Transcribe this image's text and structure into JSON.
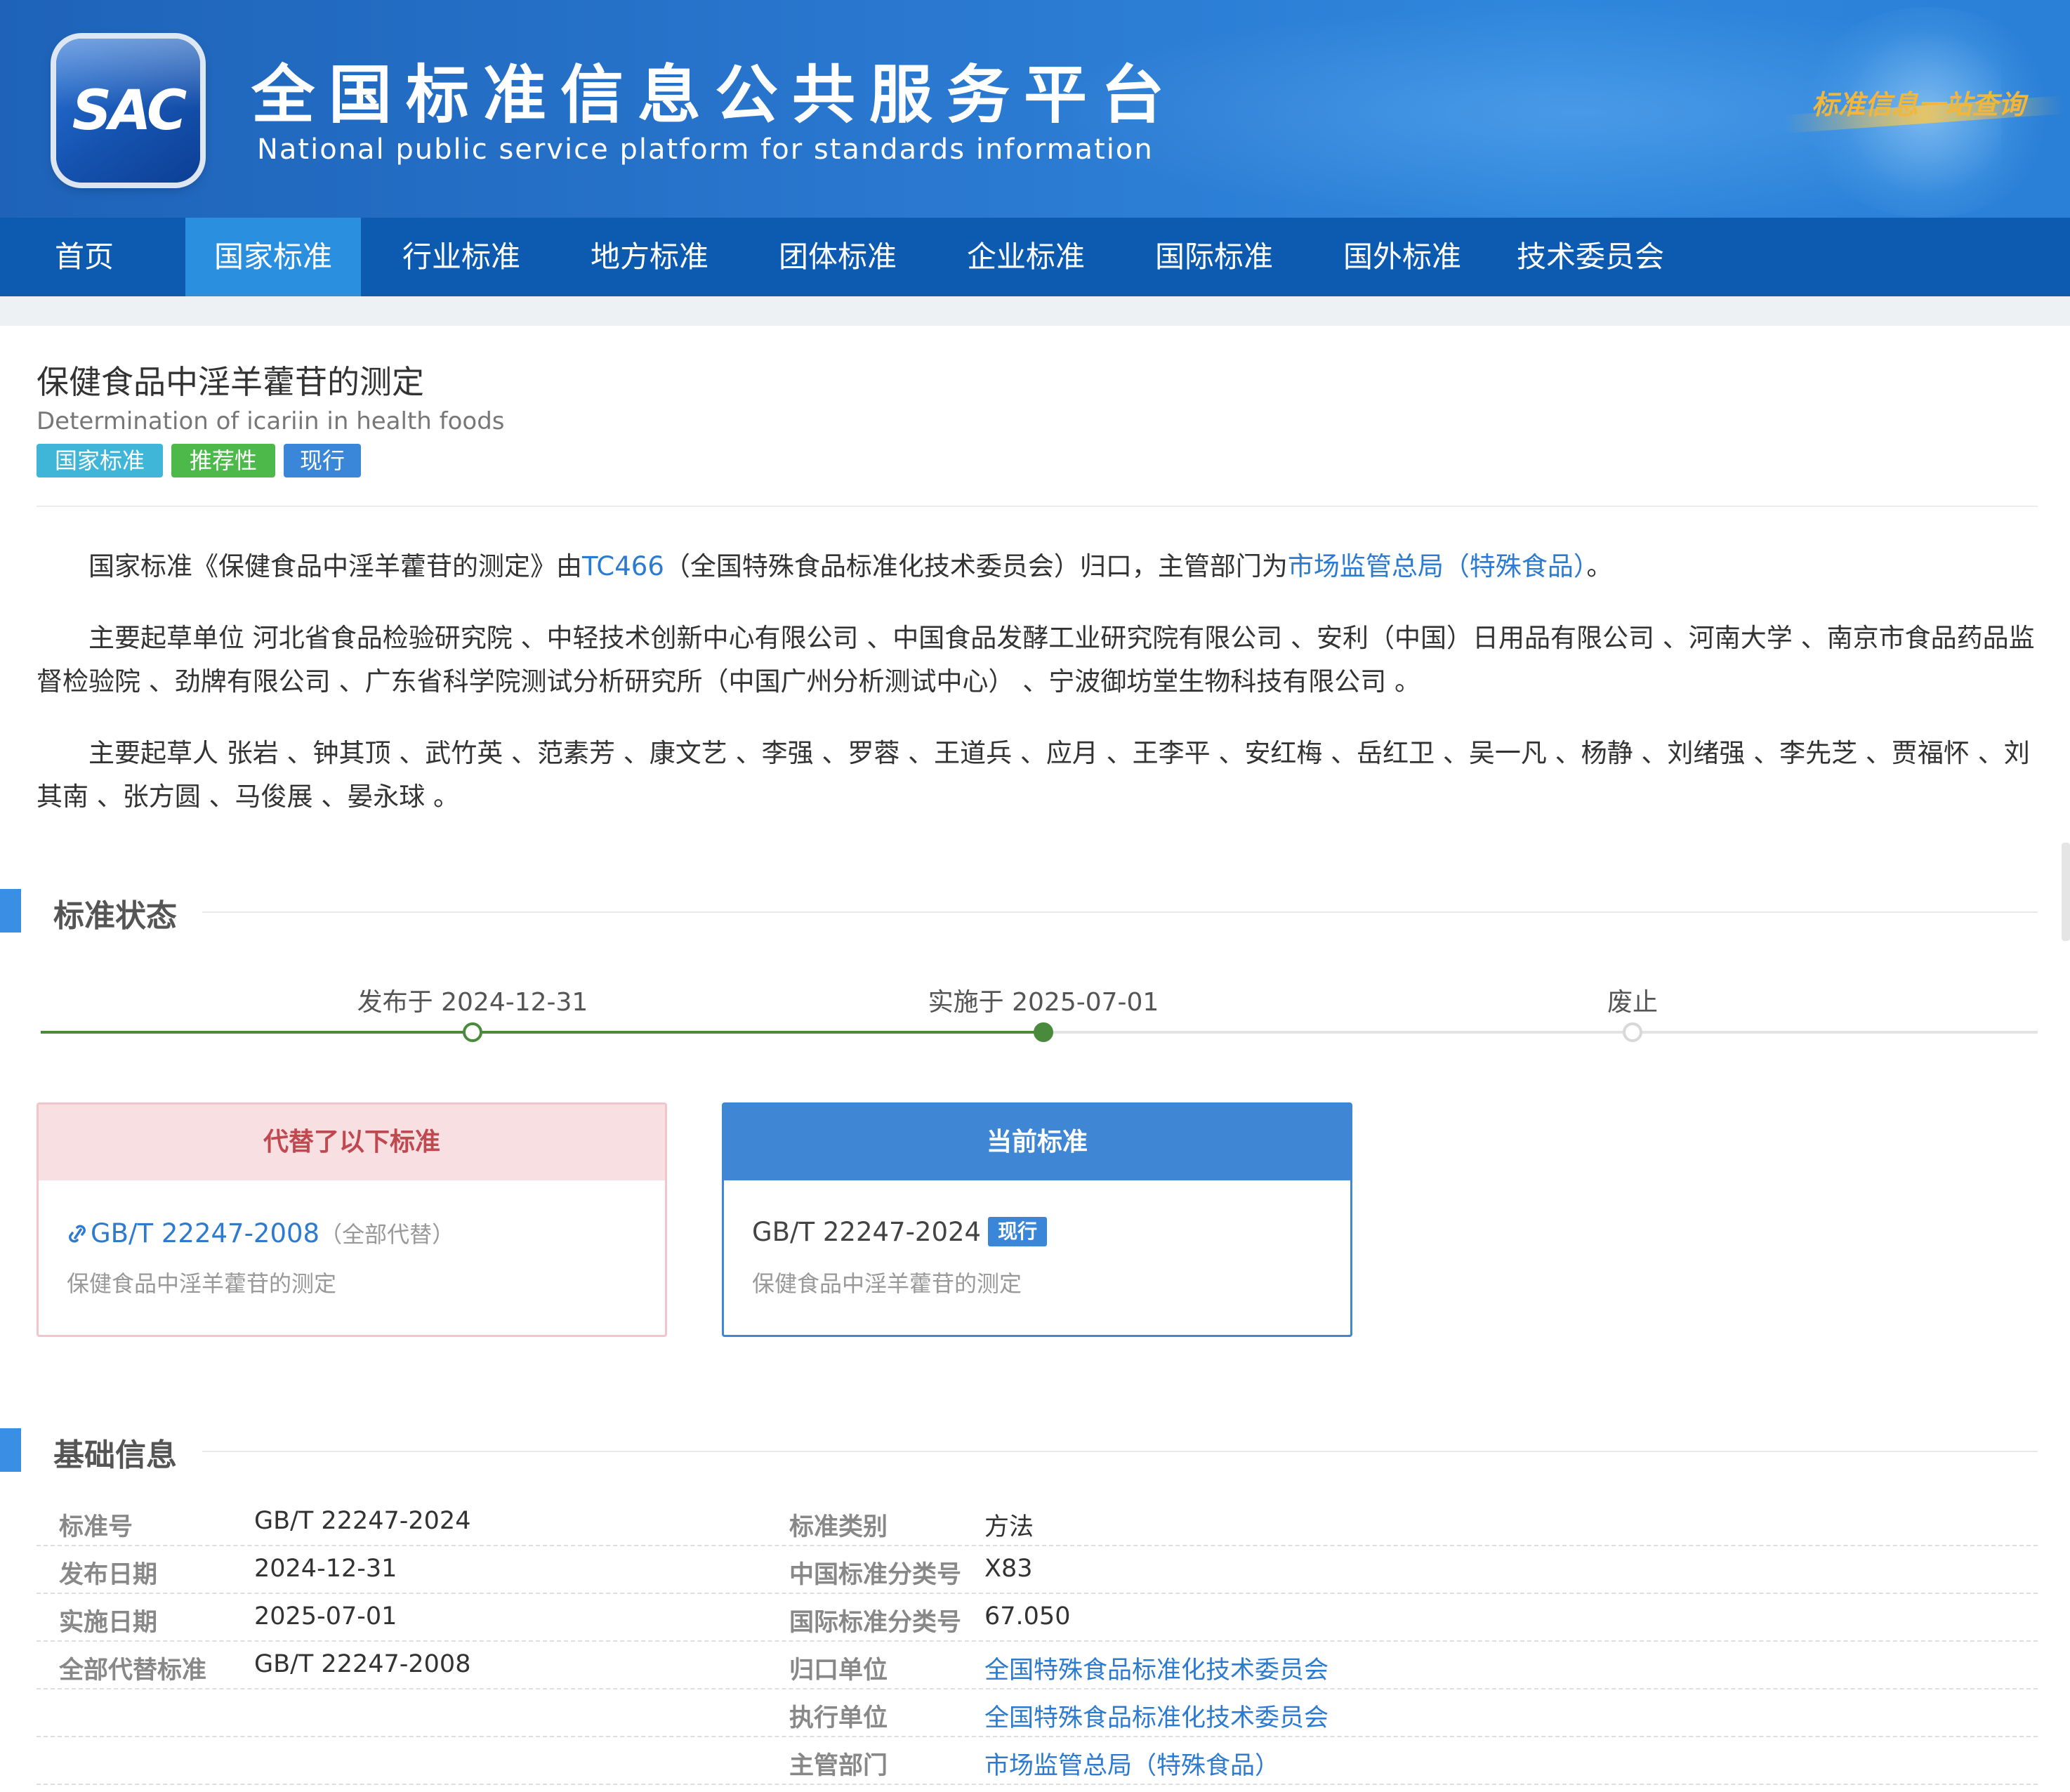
{
  "site": {
    "logo_text": "SAC",
    "title": "全国标准信息公共服务平台",
    "subtitle": "National public service platform  for standards information",
    "slogan": "标准信息一站查询"
  },
  "nav": {
    "items": [
      {
        "label": "首页",
        "active": false
      },
      {
        "label": "国家标准",
        "active": true
      },
      {
        "label": "行业标准",
        "active": false
      },
      {
        "label": "地方标准",
        "active": false
      },
      {
        "label": "团体标准",
        "active": false
      },
      {
        "label": "企业标准",
        "active": false
      },
      {
        "label": "国际标准",
        "active": false
      },
      {
        "label": "国外标准",
        "active": false
      },
      {
        "label": "技术委员会",
        "active": false
      }
    ]
  },
  "standard": {
    "title_cn": "保健食品中淫羊藿苷的测定",
    "title_en": "Determination of icariin in health foods",
    "badges": [
      {
        "label": "国家标准",
        "color": "#3fb6d8"
      },
      {
        "label": "推荐性",
        "color": "#4cb94a"
      },
      {
        "label": "现行",
        "color": "#3a86d8"
      }
    ]
  },
  "description": {
    "p1_prefix": "国家标准《保健食品中淫羊藿苷的测定》由",
    "p1_tc": "TC466",
    "p1_mid": "（全国特殊食品标准化技术委员会）归口，主管部门为",
    "p1_dept": "市场监管总局（特殊食品）",
    "p1_suffix": "。",
    "p2": "主要起草单位 河北省食品检验研究院 、中轻技术创新中心有限公司 、中国食品发酵工业研究院有限公司 、安利（中国）日用品有限公司 、河南大学 、南京市食品药品监督检验院 、劲牌有限公司 、广东省科学院测试分析研究所（中国广州分析测试中心） 、宁波御坊堂生物科技有限公司 。",
    "p3": "主要起草人 张岩 、钟其顶 、武竹英 、范素芳 、康文艺 、李强 、罗蓉 、王道兵 、应月 、王李平 、安红梅 、岳红卫 、吴一凡 、杨静 、刘绪强 、李先芝 、贾福怀 、刘其南 、张方圆 、马俊展 、晏永球 。"
  },
  "status_section": {
    "title": "标准状态",
    "timeline": [
      {
        "label": "发布于 2024-12-31",
        "state": "done"
      },
      {
        "label": "实施于 2025-07-01",
        "state": "current"
      },
      {
        "label": "废止",
        "state": "pending"
      }
    ],
    "replaced_card": {
      "header": "代替了以下标准",
      "code": "GB/T 22247-2008",
      "note": "（全部代替）",
      "name": "保健食品中淫羊藿苷的测定"
    },
    "current_card": {
      "header": "当前标准",
      "code": "GB/T 22247-2024",
      "badge": "现行",
      "name": "保健食品中淫羊藿苷的测定"
    }
  },
  "basic_info": {
    "title": "基础信息",
    "left": [
      {
        "label": "标准号",
        "value": "GB/T 22247-2024"
      },
      {
        "label": "发布日期",
        "value": "2024-12-31"
      },
      {
        "label": "实施日期",
        "value": "2025-07-01"
      },
      {
        "label": "全部代替标准",
        "value": "GB/T 22247-2008"
      }
    ],
    "right": [
      {
        "label": "标准类别",
        "value": "方法",
        "link": false
      },
      {
        "label": "中国标准分类号",
        "value": "X83",
        "link": false
      },
      {
        "label": "国际标准分类号",
        "value": "67.050",
        "link": false
      },
      {
        "label": "归口单位",
        "value": "全国特殊食品标准化技术委员会",
        "link": true
      },
      {
        "label": "执行单位",
        "value": "全国特殊食品标准化技术委员会",
        "link": true
      },
      {
        "label": "主管部门",
        "value": "市场监管总局（特殊食品）",
        "link": true
      }
    ]
  }
}
